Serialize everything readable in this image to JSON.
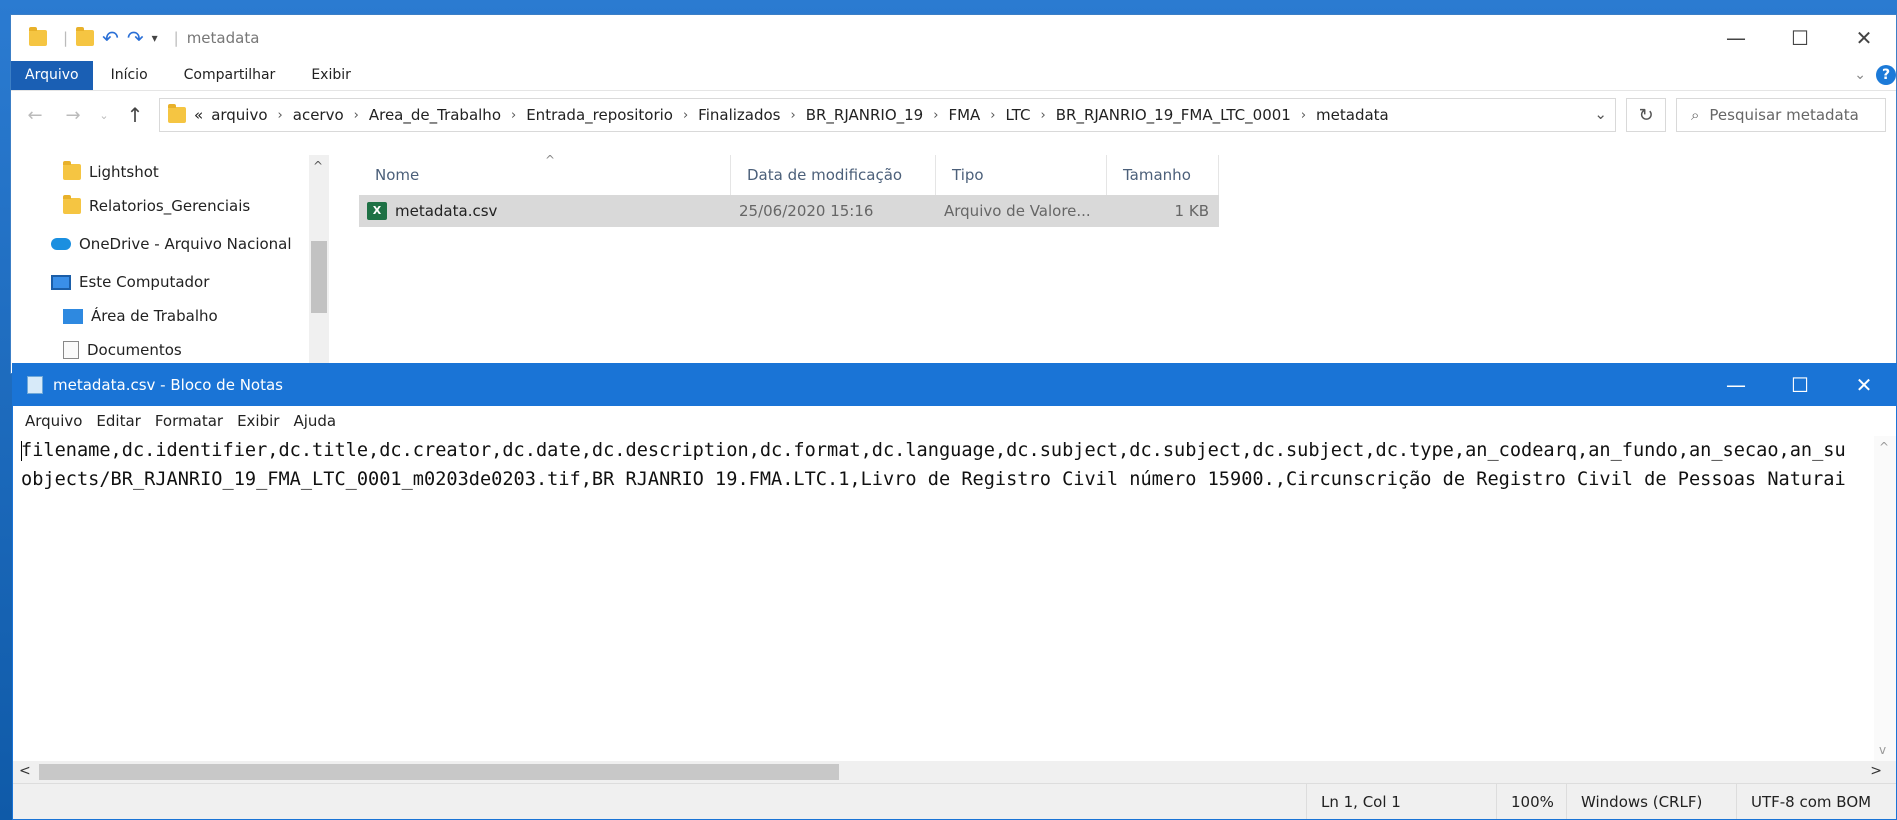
{
  "explorer": {
    "title": "metadata",
    "ribbon": {
      "file": "Arquivo",
      "home": "Início",
      "share": "Compartilhar",
      "view": "Exibir"
    },
    "path": [
      "«",
      "arquivo",
      "acervo",
      "Area_de_Trabalho",
      "Entrada_repositorio",
      "Finalizados",
      "BR_RJANRIO_19",
      "FMA",
      "LTC",
      "BR_RJANRIO_19_FMA_LTC_0001",
      "metadata"
    ],
    "search_placeholder": "Pesquisar metadata",
    "nav_items": [
      {
        "label": "Lightshot",
        "icon": "folder-icon"
      },
      {
        "label": "Relatorios_Gerenciais",
        "icon": "folder-icon"
      },
      {
        "label": "OneDrive - Arquivo Nacional",
        "icon": "onedrive-icon"
      },
      {
        "label": "Este Computador",
        "icon": "computer-icon"
      },
      {
        "label": "Área de Trabalho",
        "icon": "desktop-icon"
      },
      {
        "label": "Documentos",
        "icon": "documents-icon"
      }
    ],
    "columns": [
      "Nome",
      "Data de modificação",
      "Tipo",
      "Tamanho"
    ],
    "files": [
      {
        "name": "metadata.csv",
        "modified": "25/06/2020 15:16",
        "type": "Arquivo de Valore...",
        "size": "1 KB"
      }
    ]
  },
  "notepad": {
    "title": "metadata.csv - Bloco de Notas",
    "menu": [
      "Arquivo",
      "Editar",
      "Formatar",
      "Exibir",
      "Ajuda"
    ],
    "lines": [
      "filename,dc.identifier,dc.title,dc.creator,dc.date,dc.description,dc.format,dc.language,dc.subject,dc.subject,dc.subject,dc.type,an_codearq,an_fundo,an_secao,an_su",
      "objects/BR_RJANRIO_19_FMA_LTC_0001_m0203de0203.tif,BR RJANRIO 19.FMA.LTC.1,Livro de Registro Civil número 15900.,Circunscrição de Registro Civil de Pessoas Naturai"
    ],
    "status": {
      "position": "Ln 1, Col 1",
      "zoom": "100%",
      "line_ending": "Windows (CRLF)",
      "encoding": "UTF-8 com BOM"
    }
  }
}
